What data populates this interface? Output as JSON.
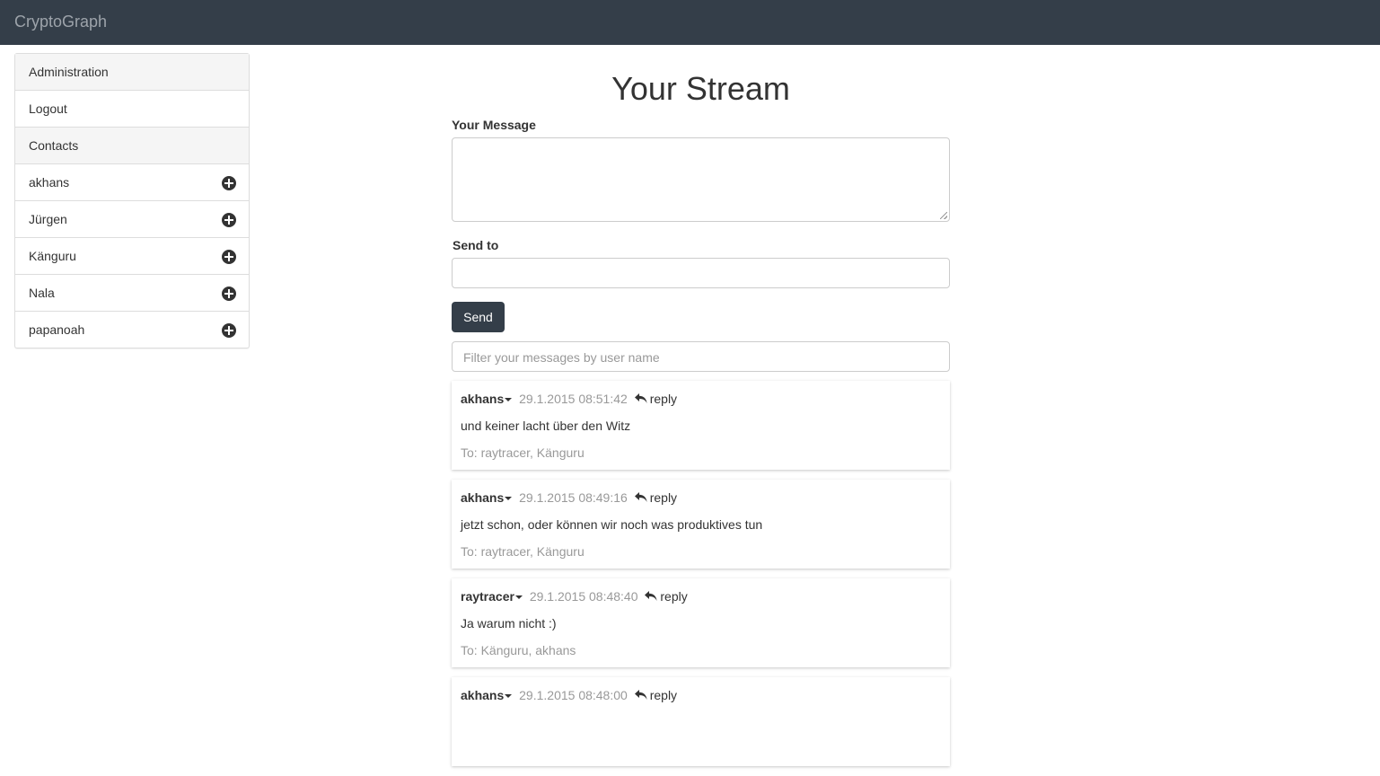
{
  "app": {
    "brand": "CryptoGraph"
  },
  "sidebar": {
    "administration": "Administration",
    "logout": "Logout",
    "contacts_heading": "Contacts",
    "contacts": [
      {
        "name": "akhans"
      },
      {
        "name": "Jürgen"
      },
      {
        "name": "Känguru"
      },
      {
        "name": "Nala"
      },
      {
        "name": "papanoah"
      }
    ]
  },
  "main": {
    "title": "Your Stream",
    "message_label": "Your Message",
    "send_to_label": "Send to",
    "send_button": "Send",
    "filter_placeholder": "Filter your messages by user name"
  },
  "messages": [
    {
      "user": "akhans",
      "time": "29.1.2015 08:51:42",
      "reply": "reply",
      "text": "und keiner lacht über den Witz",
      "to": "To: raytracer, Känguru"
    },
    {
      "user": "akhans",
      "time": "29.1.2015 08:49:16",
      "reply": "reply",
      "text": "jetzt schon, oder können wir noch was produktives tun",
      "to": "To: raytracer, Känguru"
    },
    {
      "user": "raytracer",
      "time": "29.1.2015 08:48:40",
      "reply": "reply",
      "text": "Ja warum nicht :)",
      "to": "To: Känguru, akhans"
    },
    {
      "user": "akhans",
      "time": "29.1.2015 08:48:00",
      "reply": "reply",
      "text": "",
      "to": ""
    }
  ],
  "colors": {
    "navbar": "#343e49",
    "brand_text": "#9da3aa",
    "muted_text": "#999999",
    "primary_button": "#343e49"
  },
  "icons": {
    "add_contact": "plus-circle-icon",
    "reply": "reply-arrow-icon",
    "user_menu": "caret-down-icon"
  }
}
